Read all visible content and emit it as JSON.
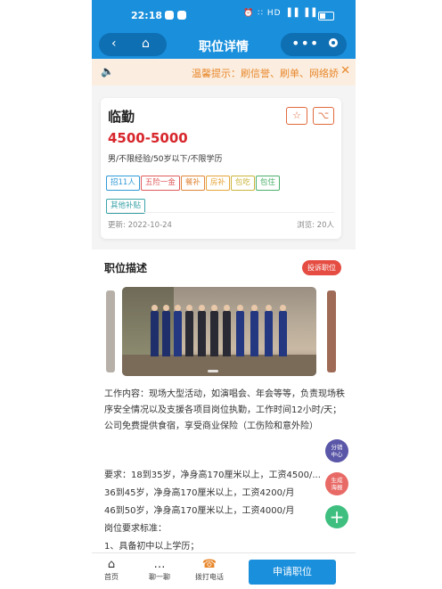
{
  "status_bar": {
    "time": "22:18",
    "signal": "⏰ ∷ HD ▐▐ ▐▐"
  },
  "nav": {
    "back_icon": "‹",
    "home_icon": "⌂",
    "title": "职位详情",
    "more_icon": "•••"
  },
  "notice": {
    "speaker_icon": "🔈",
    "text": "温馨提示：刷信誉、刷单、网络娇",
    "close": "✕"
  },
  "job": {
    "title": "临勤",
    "salary": "4500-5000",
    "requirements": "男/不限经验/50岁以下/不限学历",
    "favorite_icon": "☆",
    "share_icon": "⌥",
    "tags": [
      {
        "label": "招11人",
        "color": "#2f9ad6"
      },
      {
        "label": "五险一金",
        "color": "#e05a5a"
      },
      {
        "label": "餐补",
        "color": "#e0873a"
      },
      {
        "label": "房补",
        "color": "#e6a53a"
      },
      {
        "label": "包吃",
        "color": "#c9b53a"
      },
      {
        "label": "包住",
        "color": "#4bb06a"
      },
      {
        "label": "其他补贴",
        "color": "#3aa3a8"
      }
    ],
    "updated": "更新: 2022-10-24",
    "views": "浏览: 20人"
  },
  "description": {
    "title": "职位描述",
    "report_button": "投诉职位",
    "paragraph1": "工作内容：现场大型活动，如演唱会、年会等等，负责现场秩序安全情况以及支援各项目岗位执勤，工作时间12小时/天；公司免费提供食宿，享受商业保险（工伤险和意外险）",
    "lines": [
      "要求：18到35岁，净身高170厘米以上，工资4500/...",
      "36到45岁，净身高170厘米以上，工资4200/月",
      "46到50岁，净身高170厘米以上，工资4000/月",
      "岗位要求标准：",
      "1、具备初中以上学历；"
    ]
  },
  "floating": {
    "distribution": "分销中心",
    "poster": "生成海报",
    "plus": "+"
  },
  "bottom_bar": {
    "home": "首页",
    "chat": "聊一聊",
    "call": "拨打电话",
    "apply": "申请职位",
    "home_icon": "⌂",
    "chat_icon": "…",
    "call_icon": "☎"
  },
  "colors": {
    "primary": "#1a8fdc",
    "salary": "#d7262c",
    "accent": "#e06a3c",
    "report": "#e54d42"
  }
}
